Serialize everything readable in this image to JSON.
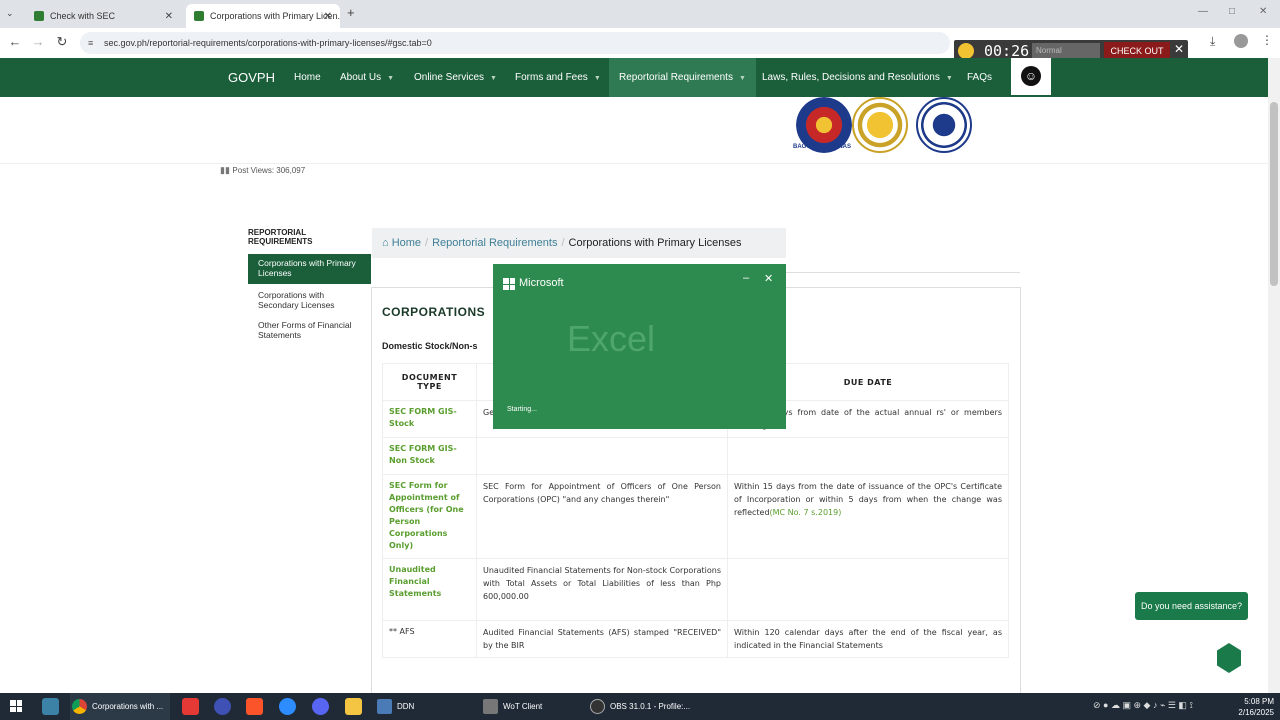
{
  "browser": {
    "tabs": [
      {
        "label": "Check with SEC",
        "active": false
      },
      {
        "label": "Corporations with Primary Licen...",
        "active": true
      }
    ],
    "new_tab": "+",
    "url": "sec.gov.ph/reportorial-requirements/corporations-with-primary-licenses/#gsc.tab=0",
    "window_controls": {
      "minimize": "—",
      "maximize": "□",
      "close": "✕"
    }
  },
  "overlay": {
    "timer": "00:26",
    "mode": "Normal",
    "checkout": "CHECK OUT",
    "close": "✕"
  },
  "site_nav": {
    "brand": "GOVPH",
    "items": [
      {
        "label": "Home",
        "has_caret": false
      },
      {
        "label": "About Us",
        "has_caret": true
      },
      {
        "label": "Online Services",
        "has_caret": true
      },
      {
        "label": "Forms and Fees",
        "has_caret": true
      },
      {
        "label": "Reportorial Requirements",
        "has_caret": true
      },
      {
        "label": "Laws, Rules, Decisions and Resolutions",
        "has_caret": true
      },
      {
        "label": "FAQs",
        "has_caret": false
      }
    ],
    "accent": "#1a5e3a"
  },
  "header": {
    "seal_caption": "BAGONG PILIPINAS"
  },
  "post_views": "Post Views: 306,097",
  "sidebar": {
    "title": "REPORTORIAL REQUIREMENTS",
    "items": [
      {
        "label": "Corporations with Primary Licenses",
        "active": true
      },
      {
        "label": "Corporations with Secondary Licenses",
        "active": false
      },
      {
        "label": "Other Forms of Financial Statements",
        "active": false
      }
    ]
  },
  "breadcrumb": {
    "home": "Home",
    "section": "Reportorial Requirements",
    "current": "Corporations with Primary Licenses"
  },
  "main": {
    "title": "CORPORATIONS",
    "subtitle": "Domestic Stock/Non-s",
    "table": {
      "headers": [
        "DOCUMENT TYPE",
        "",
        "DUE DATE"
      ],
      "rows": [
        {
          "doc": "SEC FORM GIS-Stock",
          "desc": "Ge",
          "due": "calendar days from date of the actual annual rs' or members meeting"
        },
        {
          "doc": "SEC FORM GIS-Non Stock",
          "desc": "",
          "due": ""
        },
        {
          "doc": "SEC Form for Appointment of Officers (for One Person Corporations Only)",
          "desc": "SEC Form for Appointment of Officers of One Person Corporations (OPC) \"and any changes therein\"",
          "due": "Within 15 days from the date of issuance of the OPC's Certificate of Incorporation or within 5 days from when the change was reflected",
          "due_link": "(MC No. 7 s.2019)"
        },
        {
          "doc": "Unaudited Financial Statements",
          "desc": "Unaudited Financial Statements for Non-stock Corporations with Total Assets or Total Liabilities of less than Php 600,000.00",
          "due": ""
        },
        {
          "doc": "** AFS",
          "desc": "Audited Financial Statements (AFS) stamped \"RECEIVED\" by the BIR",
          "due": "Within 120 calendar days after the end of the fiscal year, as indicated in the Financial Statements"
        }
      ]
    }
  },
  "excel_splash": {
    "brand": "Microsoft",
    "app": "Excel",
    "status": "Starting...",
    "color": "#2e8b4f"
  },
  "chat": {
    "label": "Do you need assistance?"
  },
  "taskbar": {
    "apps": [
      {
        "label": "Corporations with ..."
      },
      {
        "label": "DDN"
      },
      {
        "label": "WoT Client"
      },
      {
        "label": "OBS 31.0.1 - Profile:..."
      }
    ],
    "clock_time": "5:08 PM",
    "clock_date": "2/16/2025"
  }
}
